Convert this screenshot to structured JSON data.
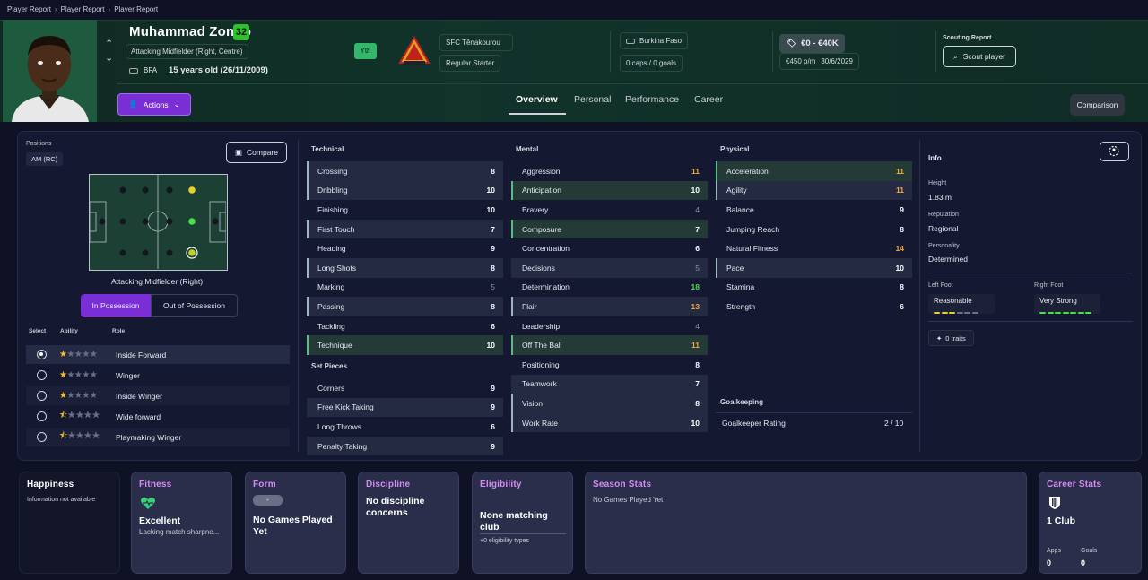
{
  "breadcrumb": [
    "Player Report",
    "Player Report",
    "Player Report"
  ],
  "player": {
    "name": "Muhammad Zongo",
    "ca": "32",
    "position": "Attacking Midfielder (Right, Centre)",
    "nationality_code": "BFA",
    "age": "15 years old (26/11/2009)",
    "youth_badge": "Yth",
    "club": "SFC Tênakourou",
    "squad_status": "Regular Starter",
    "country": "Burkina Faso",
    "caps": "0 caps / 0 goals",
    "value": "€0 - €40K",
    "wage": "€450 p/m",
    "contract_end": "30/6/2029"
  },
  "scouting": {
    "label": "Scouting Report",
    "button": "Scout player"
  },
  "actions_label": "Actions",
  "tabs": [
    "Overview",
    "Personal",
    "Performance",
    "Career"
  ],
  "comparison_label": "Comparison",
  "positions": {
    "label": "Positions",
    "tag": "AM (RC)",
    "compare": "Compare",
    "caption": "Attacking Midfielder (Right)"
  },
  "possession": {
    "in": "In Possession",
    "out": "Out of Possession"
  },
  "roles_header": {
    "select": "Select",
    "ability": "Ability",
    "role": "Role"
  },
  "roles": [
    {
      "name": "Inside Forward",
      "stars": 1,
      "selected": true
    },
    {
      "name": "Winger",
      "stars": 1,
      "selected": false
    },
    {
      "name": "Inside Winger",
      "stars": 1,
      "selected": false
    },
    {
      "name": "Wide forward",
      "stars": 0.5,
      "selected": false
    },
    {
      "name": "Playmaking Winger",
      "stars": 0.5,
      "selected": false
    }
  ],
  "technical": {
    "title": "Technical",
    "items": [
      {
        "name": "Crossing",
        "value": "8"
      },
      {
        "name": "Dribbling",
        "value": "10"
      },
      {
        "name": "Finishing",
        "value": "10"
      },
      {
        "name": "First Touch",
        "value": "7"
      },
      {
        "name": "Heading",
        "value": "9"
      },
      {
        "name": "Long Shots",
        "value": "8"
      },
      {
        "name": "Marking",
        "value": "5"
      },
      {
        "name": "Passing",
        "value": "8"
      },
      {
        "name": "Tackling",
        "value": "6"
      },
      {
        "name": "Technique",
        "value": "10"
      }
    ]
  },
  "set_pieces": {
    "title": "Set Pieces",
    "items": [
      {
        "name": "Corners",
        "value": "9"
      },
      {
        "name": "Free Kick Taking",
        "value": "9"
      },
      {
        "name": "Long Throws",
        "value": "6"
      },
      {
        "name": "Penalty Taking",
        "value": "9"
      }
    ]
  },
  "mental": {
    "title": "Mental",
    "items": [
      {
        "name": "Aggression",
        "value": "11"
      },
      {
        "name": "Anticipation",
        "value": "10"
      },
      {
        "name": "Bravery",
        "value": "4"
      },
      {
        "name": "Composure",
        "value": "7"
      },
      {
        "name": "Concentration",
        "value": "6"
      },
      {
        "name": "Decisions",
        "value": "5"
      },
      {
        "name": "Determination",
        "value": "18"
      },
      {
        "name": "Flair",
        "value": "13"
      },
      {
        "name": "Leadership",
        "value": "4"
      },
      {
        "name": "Off The Ball",
        "value": "11"
      },
      {
        "name": "Positioning",
        "value": "8"
      },
      {
        "name": "Teamwork",
        "value": "7"
      },
      {
        "name": "Vision",
        "value": "8"
      },
      {
        "name": "Work Rate",
        "value": "10"
      }
    ]
  },
  "physical": {
    "title": "Physical",
    "items": [
      {
        "name": "Acceleration",
        "value": "11"
      },
      {
        "name": "Agility",
        "value": "11"
      },
      {
        "name": "Balance",
        "value": "9"
      },
      {
        "name": "Jumping Reach",
        "value": "8"
      },
      {
        "name": "Natural Fitness",
        "value": "14"
      },
      {
        "name": "Pace",
        "value": "10"
      },
      {
        "name": "Stamina",
        "value": "8"
      },
      {
        "name": "Strength",
        "value": "6"
      }
    ]
  },
  "goalkeeping": {
    "title": "Goalkeeping",
    "rating_label": "Goalkeeper Rating",
    "rating": "2 / 10"
  },
  "info": {
    "title": "Info",
    "height_label": "Height",
    "height": "1.83 m",
    "reputation_label": "Reputation",
    "reputation": "Regional",
    "personality_label": "Personality",
    "personality": "Determined",
    "left_foot_label": "Left Foot",
    "left_foot": "Reasonable",
    "right_foot_label": "Right Foot",
    "right_foot": "Very Strong",
    "traits": "0 traits"
  },
  "cards": {
    "happiness": {
      "title": "Happiness",
      "text": "Information not available"
    },
    "fitness": {
      "title": "Fitness",
      "status": "Excellent",
      "note": "Lacking match sharpne..."
    },
    "form": {
      "title": "Form",
      "badge": "-",
      "text": "No Games Played Yet"
    },
    "discipline": {
      "title": "Discipline",
      "text": "No discipline concerns"
    },
    "eligibility": {
      "title": "Eligibility",
      "text": "None matching club",
      "note": "+0 eligibility types"
    },
    "season": {
      "title": "Season Stats",
      "text": "No Games Played Yet"
    },
    "career": {
      "title": "Career Stats",
      "clubs": "1 Club",
      "apps_label": "Apps",
      "apps": "0",
      "goals_label": "Goals",
      "goals": "0"
    }
  },
  "colors": {
    "accent_purple": "#7a2ed6",
    "ca_green": "#2fbf2f",
    "card_title": "#d48cf2",
    "star": "#f2c028"
  }
}
